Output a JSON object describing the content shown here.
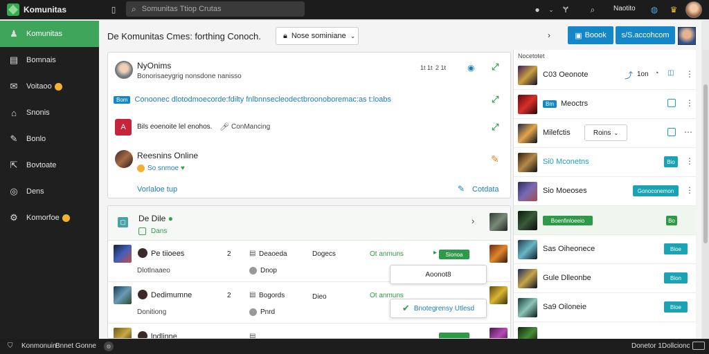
{
  "app": {
    "name": "Komunitas"
  },
  "topbar": {
    "search_placeholder": "Somunitas Ttiop Crutas",
    "user_label": "Naotito"
  },
  "sidebar": {
    "items": [
      {
        "label": "Komunitas",
        "icon": "community-icon"
      },
      {
        "label": "Bomnais",
        "icon": "games-icon"
      },
      {
        "label": "Voitaoo",
        "icon": "mail-icon"
      },
      {
        "label": "Snonis",
        "icon": "home-icon"
      },
      {
        "label": "Bonlo",
        "icon": "tools-icon"
      },
      {
        "label": "Bovtoate",
        "icon": "export-icon"
      },
      {
        "label": "Dens",
        "icon": "target-icon"
      },
      {
        "label": "Komorfoe",
        "icon": "gear-icon"
      }
    ]
  },
  "header": {
    "title": "De Komunitas Cmes: forthing Conoch.",
    "sort_label": "Nose sominiane",
    "btn1_label": "Boook",
    "btn2_label": "s/S.accohcom"
  },
  "feed": {
    "user": {
      "name": "NyOnims",
      "subtitle": "Bonorisaeygrig nonsdone nanisso",
      "time1": "1t 1t",
      "time2": "2 1t"
    },
    "announcement": {
      "tag": "Bom",
      "text": "Conoonec dlotodmoecorde:fdilty fnlbnnsecleodectbroonoboremac:as t:loabs"
    },
    "post2": {
      "tile": "A",
      "text": "Bils eoenoite lel enohos.",
      "suffix": "ConMancing"
    },
    "post3": {
      "title": "Reesnins Online",
      "sub": "So snmoe"
    },
    "footer": {
      "left": "Vorlaloe tup",
      "right": "Cotdata"
    }
  },
  "table": {
    "group": {
      "title": "De Dile",
      "sub": "Dans"
    },
    "rows": [
      {
        "name": "Pe tiioees",
        "sub": "Dlotlnaaeo",
        "count": "2",
        "c1": "Deaoeda",
        "c2": "Dnop",
        "c3": "Dogecs",
        "c4": "Ot anmuns",
        "pill": "Sionoa"
      },
      {
        "name": "Dedimumne",
        "sub": "Donitiong",
        "count": "2",
        "c1": "Bogords",
        "c2": "Pnrd",
        "c3": "Dieo",
        "c4": "Ot anmuns",
        "pill": ""
      },
      {
        "name": "lndlinne",
        "sub": "",
        "count": "",
        "c1": "",
        "c2": "",
        "c3": "",
        "c4": "",
        "pill": ""
      }
    ],
    "popup1": "Aoonot8",
    "popup2": "Bnotegrensy Utlesd"
  },
  "right_panel": {
    "header": "Nocetotet",
    "rows": [
      {
        "label": "C03 Oeonote",
        "extra": "1on",
        "color": "#222"
      },
      {
        "label": "Meoctrs",
        "extra": "Bm",
        "color": "#222"
      },
      {
        "label": "Milefctis",
        "extra": "Roins",
        "color": "#222"
      },
      {
        "label": "Si0 Mconetns",
        "extra": "Bio",
        "color": "#1aa3b4"
      },
      {
        "label": "Sio Moeoses",
        "extra": "Gonoconemon",
        "color": "#222"
      },
      {
        "label": "Boenfinloeeio",
        "extra": "Bo",
        "color": "#2e9a48"
      },
      {
        "label": "Sas Oiheonece",
        "extra": "Bioe",
        "color": "#222"
      },
      {
        "label": "Gule Dlleonbe",
        "extra": "Bion",
        "color": "#222"
      },
      {
        "label": "Sa9 Oiloneie",
        "extra": "Bioe",
        "color": "#222"
      },
      {
        "label": "",
        "extra": "",
        "color": "#222"
      }
    ]
  },
  "bottombar": {
    "left1": "Konmonuin",
    "left2": "Bnnet Gonne",
    "right": "Donetor 1Dollcionc"
  },
  "colors": {
    "accent": "#3fa55a",
    "blue": "#1487c9",
    "teal": "#1aa3b4",
    "dark": "#1f1f1f"
  }
}
